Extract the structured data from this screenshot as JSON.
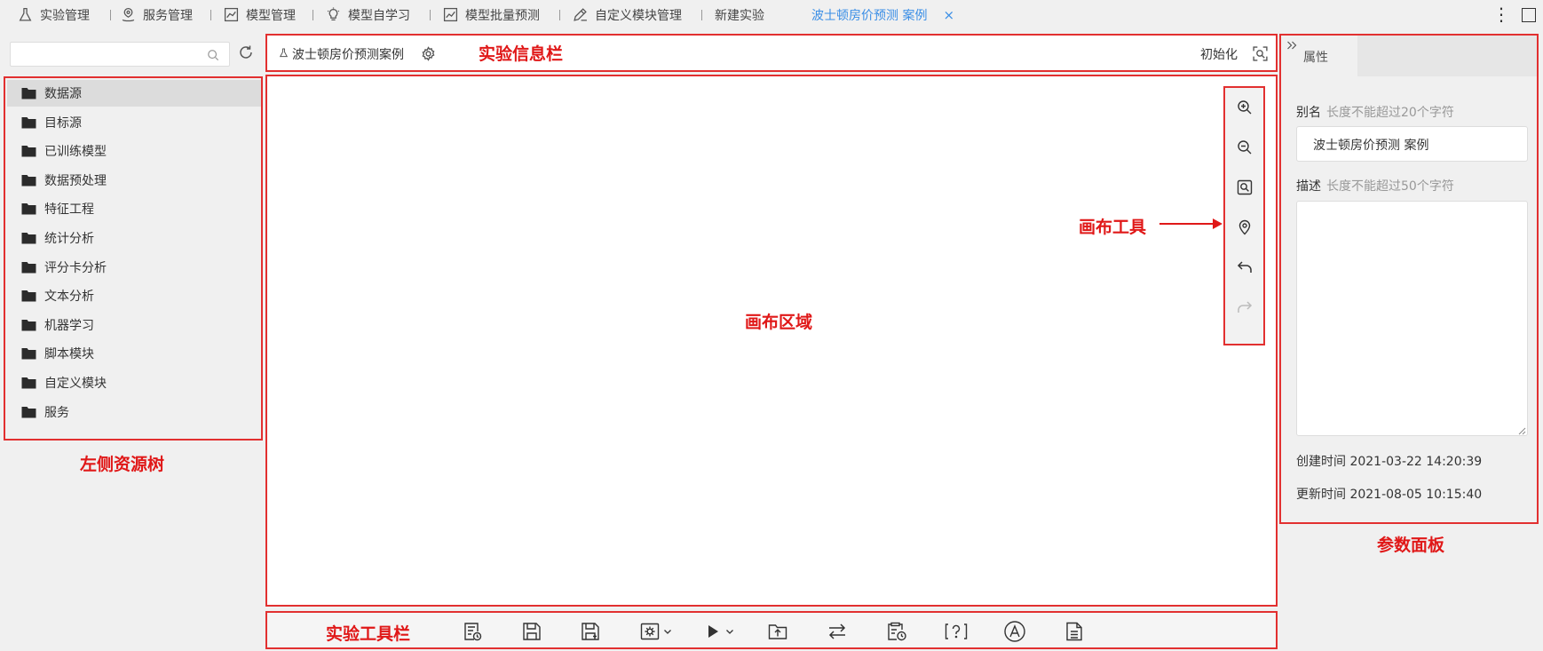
{
  "topnav": {
    "items": [
      {
        "label": "实验管理",
        "icon": "flask-icon"
      },
      {
        "label": "服务管理",
        "icon": "service-icon"
      },
      {
        "label": "模型管理",
        "icon": "chart-icon"
      },
      {
        "label": "模型自学习",
        "icon": "lightbulb-icon"
      },
      {
        "label": "模型批量预测",
        "icon": "line-chart-icon"
      },
      {
        "label": "自定义模块管理",
        "icon": "edit-icon"
      },
      {
        "label": "新建实验"
      },
      {
        "label": "波士顿房价预测 案例",
        "active": true
      }
    ],
    "close_symbol": "×",
    "more_symbol": "⋮",
    "accent": "#3a8ee6"
  },
  "left_panel": {
    "search": {
      "placeholder": ""
    },
    "tree": [
      {
        "label": "数据源",
        "selected": true
      },
      {
        "label": "目标源"
      },
      {
        "label": "已训练模型"
      },
      {
        "label": "数据预处理"
      },
      {
        "label": "特征工程"
      },
      {
        "label": "统计分析"
      },
      {
        "label": "评分卡分析"
      },
      {
        "label": "文本分析"
      },
      {
        "label": "机器学习"
      },
      {
        "label": "脚本模块"
      },
      {
        "label": "自定义模块"
      },
      {
        "label": "服务"
      }
    ]
  },
  "infobar": {
    "experiment_name": "波士顿房价预测案例",
    "init_label": "初始化"
  },
  "annotations": {
    "infobar": "实验信息栏",
    "tree": "左侧资源树",
    "canvas": "画布区域",
    "canvas_tools": "画布工具",
    "toolbar": "实验工具栏",
    "params": "参数面板",
    "color": "#e01818"
  },
  "canvas_tools": [
    "zoom-in-icon",
    "zoom-out-icon",
    "fit-view-icon",
    "locate-icon",
    "undo-icon",
    "redo-icon"
  ],
  "toolbar_icons": [
    "run-log-icon",
    "save-icon",
    "save-as-icon",
    "settings-icon",
    "run-icon",
    "publish-icon",
    "swap-icon",
    "schedule-icon",
    "help-icon",
    "auto-icon",
    "document-icon"
  ],
  "right_panel": {
    "tab_label": "属性",
    "alias_label": "别名",
    "alias_hint": "长度不能超过20个字符",
    "alias_value": "波士顿房价预测 案例",
    "desc_label": "描述",
    "desc_hint": "长度不能超过50个字符",
    "desc_value": "",
    "created_label": "创建时间",
    "created_value": "2021-03-22 14:20:39",
    "updated_label": "更新时间",
    "updated_value": "2021-08-05 10:15:40"
  }
}
